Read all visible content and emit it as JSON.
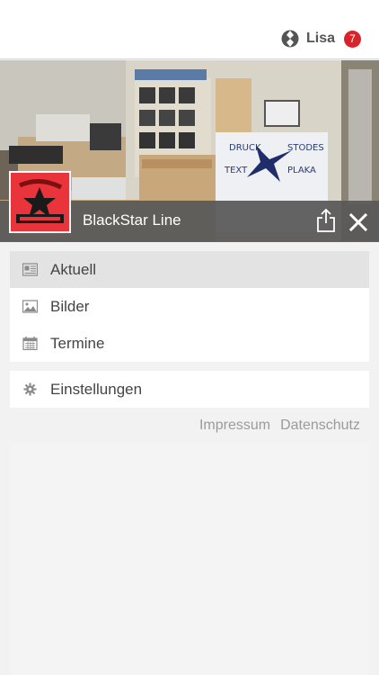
{
  "user": {
    "name": "Lisa",
    "notification_count": "7",
    "icon": "user-avatar-icon"
  },
  "header": {
    "title": "BlackStar Line",
    "share_icon": "share-icon",
    "close_icon": "close-icon"
  },
  "logo": {
    "icon": "blackstar-logo"
  },
  "menu": {
    "primary": [
      {
        "label": "Aktuell",
        "icon": "news-icon",
        "active": true
      },
      {
        "label": "Bilder",
        "icon": "image-icon",
        "active": false
      },
      {
        "label": "Termine",
        "icon": "calendar-icon",
        "active": false
      }
    ],
    "secondary": [
      {
        "label": "Einstellungen",
        "icon": "gear-icon",
        "active": false
      }
    ]
  },
  "footer": {
    "impressum": "Impressum",
    "datenschutz": "Datenschutz"
  },
  "colors": {
    "badge": "#d8232a",
    "titlebar": "#585858",
    "active_item": "#e3e3e3",
    "accent_logo": "#e8343a"
  }
}
